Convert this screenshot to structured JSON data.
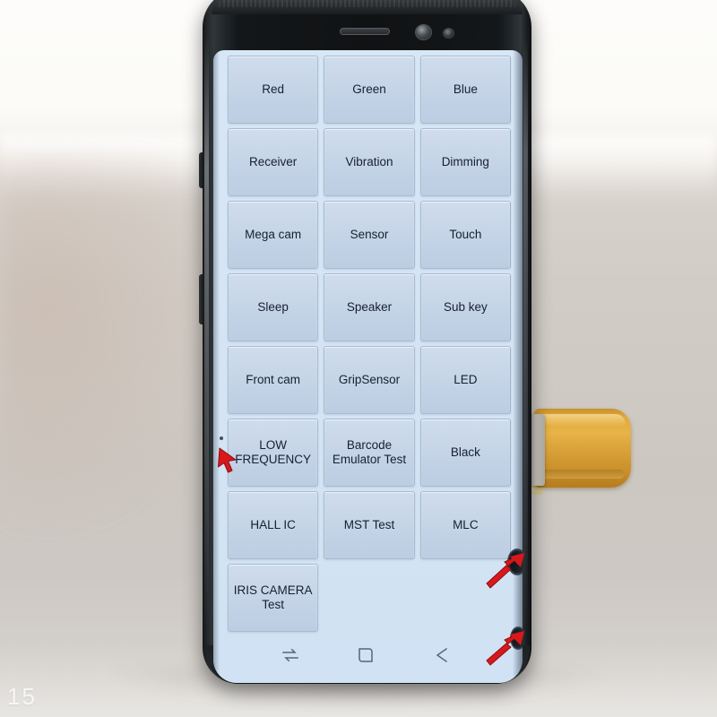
{
  "photo": {
    "subject": "Samsung Galaxy S8 display module showing factory self-test menu",
    "watermark": "15"
  },
  "device": {
    "hardware": {
      "earpiece": "earpiece-speaker",
      "front_camera": "front-camera",
      "iris_sensor": "iris-scanner",
      "flex_cable": "display-flex-ribbon-cable",
      "flex_connector": "flex-connector"
    }
  },
  "screen": {
    "background_color": "#d4e4f4",
    "button_color": "#c5d4e7",
    "button_border_color": "#aabbd2",
    "text_color": "#162033",
    "grid": {
      "columns": 3,
      "rows": 8,
      "buttons": [
        "Red",
        "Green",
        "Blue",
        "Receiver",
        "Vibration",
        "Dimming",
        "Mega cam",
        "Sensor",
        "Touch",
        "Sleep",
        "Speaker",
        "Sub key",
        "Front cam",
        "GripSensor",
        "LED",
        "LOW\nFREQUENCY",
        "Barcode\nEmulator Test",
        "Black",
        "HALL IC",
        "MST Test",
        "MLC",
        "IRIS CAMERA\nTest"
      ]
    },
    "nav_bar": {
      "items": [
        {
          "name": "recents-icon",
          "label": "Recents"
        },
        {
          "name": "home-icon",
          "label": "Home"
        },
        {
          "name": "back-icon",
          "label": "Back"
        }
      ]
    }
  },
  "annotations": {
    "arrow_color": "#d9181c",
    "markers": [
      {
        "name": "defect-marker-left",
        "points_to": "dead pixel dot near LOW FREQUENCY button"
      },
      {
        "name": "defect-marker-right-upper",
        "points_to": "dark blob on right screen edge"
      },
      {
        "name": "defect-marker-right-lower",
        "points_to": "dark blob at lower right screen edge"
      }
    ]
  }
}
